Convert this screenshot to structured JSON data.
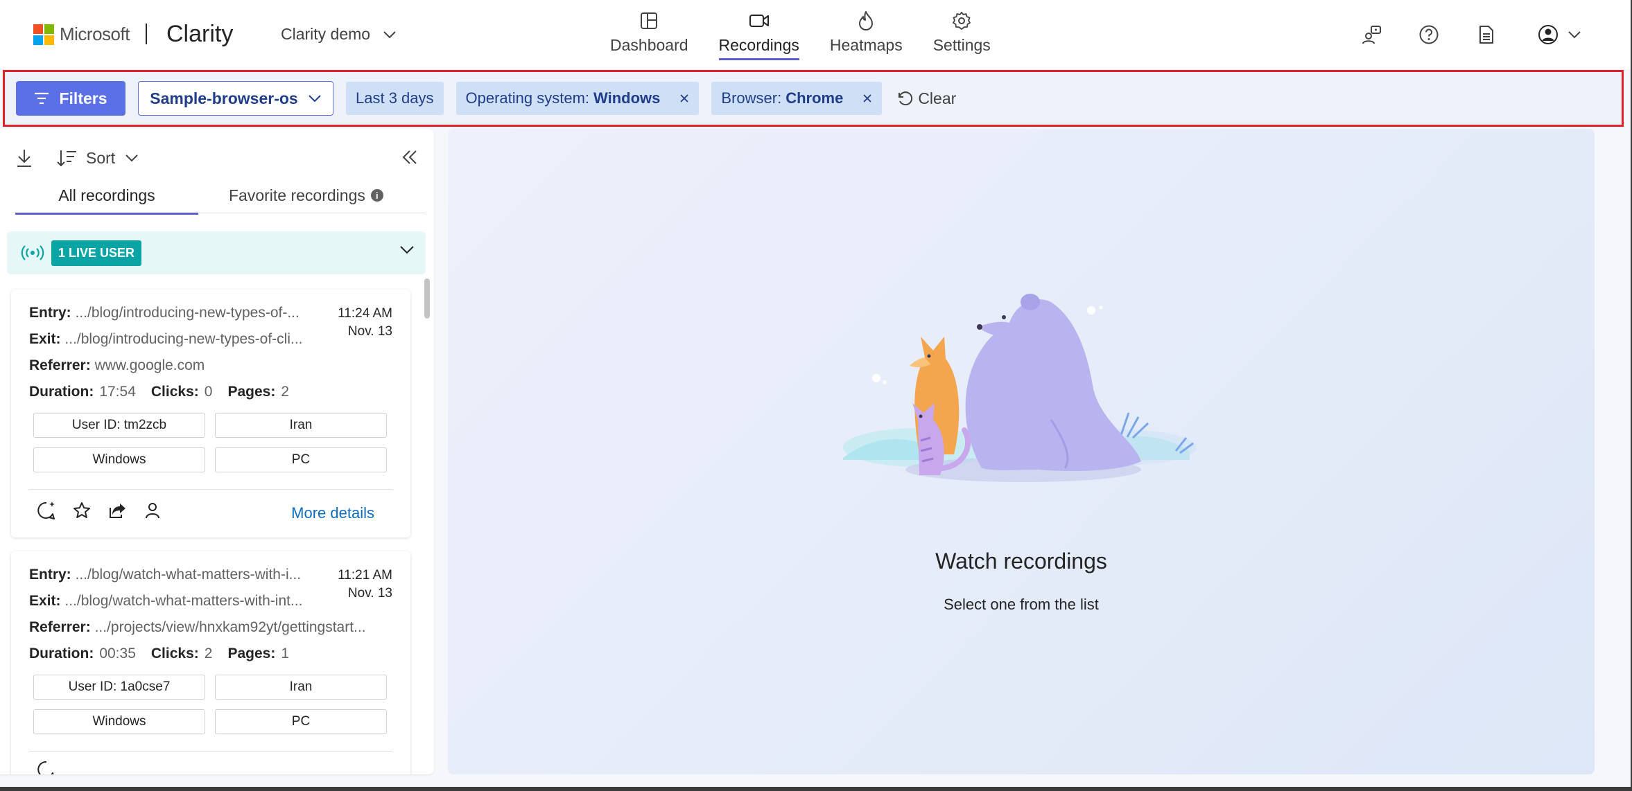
{
  "header": {
    "brand_logo": "Microsoft",
    "product": "Clarity",
    "project": "Clarity demo",
    "nav": [
      {
        "label": "Dashboard",
        "icon": "dashboard-icon"
      },
      {
        "label": "Recordings",
        "icon": "video-camera-icon",
        "active": true
      },
      {
        "label": "Heatmaps",
        "icon": "flame-icon"
      },
      {
        "label": "Settings",
        "icon": "gear-icon"
      }
    ],
    "icons": [
      "people-icon",
      "help-icon",
      "document-icon",
      "profile-icon"
    ]
  },
  "filters": {
    "filters_label": "Filters",
    "segment": "Sample-browser-os",
    "chips": [
      {
        "text": "Last 3 days"
      },
      {
        "key": "Operating system:",
        "value": "Windows"
      },
      {
        "key": "Browser:",
        "value": "Chrome"
      }
    ],
    "clear_label": "Clear"
  },
  "sidebar": {
    "sort_label": "Sort",
    "tabs": [
      "All recordings",
      "Favorite recordings"
    ],
    "info_glyph": "i",
    "live_badge": "1 LIVE USER",
    "recordings": [
      {
        "entry_label": "Entry:",
        "entry": ".../blog/introducing-new-types-of-...",
        "exit_label": "Exit:",
        "exit": ".../blog/introducing-new-types-of-cli...",
        "referrer_label": "Referrer:",
        "referrer": "www.google.com",
        "time": "11:24 AM",
        "date": "Nov. 13",
        "duration_label": "Duration:",
        "duration": "17:54",
        "clicks_label": "Clicks:",
        "clicks": "0",
        "pages_label": "Pages:",
        "pages": "2",
        "user_id": "User ID: tm2zcb",
        "country": "Iran",
        "os": "Windows",
        "device": "PC",
        "more": "More details"
      },
      {
        "entry_label": "Entry:",
        "entry": ".../blog/watch-what-matters-with-i...",
        "exit_label": "Exit:",
        "exit": ".../blog/watch-what-matters-with-int...",
        "referrer_label": "Referrer:",
        "referrer": ".../projects/view/hnxkam92yt/gettingstart...",
        "time": "11:21 AM",
        "date": "Nov. 13",
        "duration_label": "Duration:",
        "duration": "00:35",
        "clicks_label": "Clicks:",
        "clicks": "2",
        "pages_label": "Pages:",
        "pages": "1",
        "user_id": "User ID: 1a0cse7",
        "country": "Iran",
        "os": "Windows",
        "device": "PC"
      }
    ]
  },
  "main": {
    "empty_title": "Watch recordings",
    "empty_subtitle": "Select one from the list"
  },
  "colors": {
    "accent": "#5b5fc7",
    "filters_button": "#5b6fe6",
    "chip_bg": "#cfe0f6",
    "live_badge": "#0aa4a4",
    "highlight_border": "#e0202a",
    "link": "#0f6cbd"
  }
}
